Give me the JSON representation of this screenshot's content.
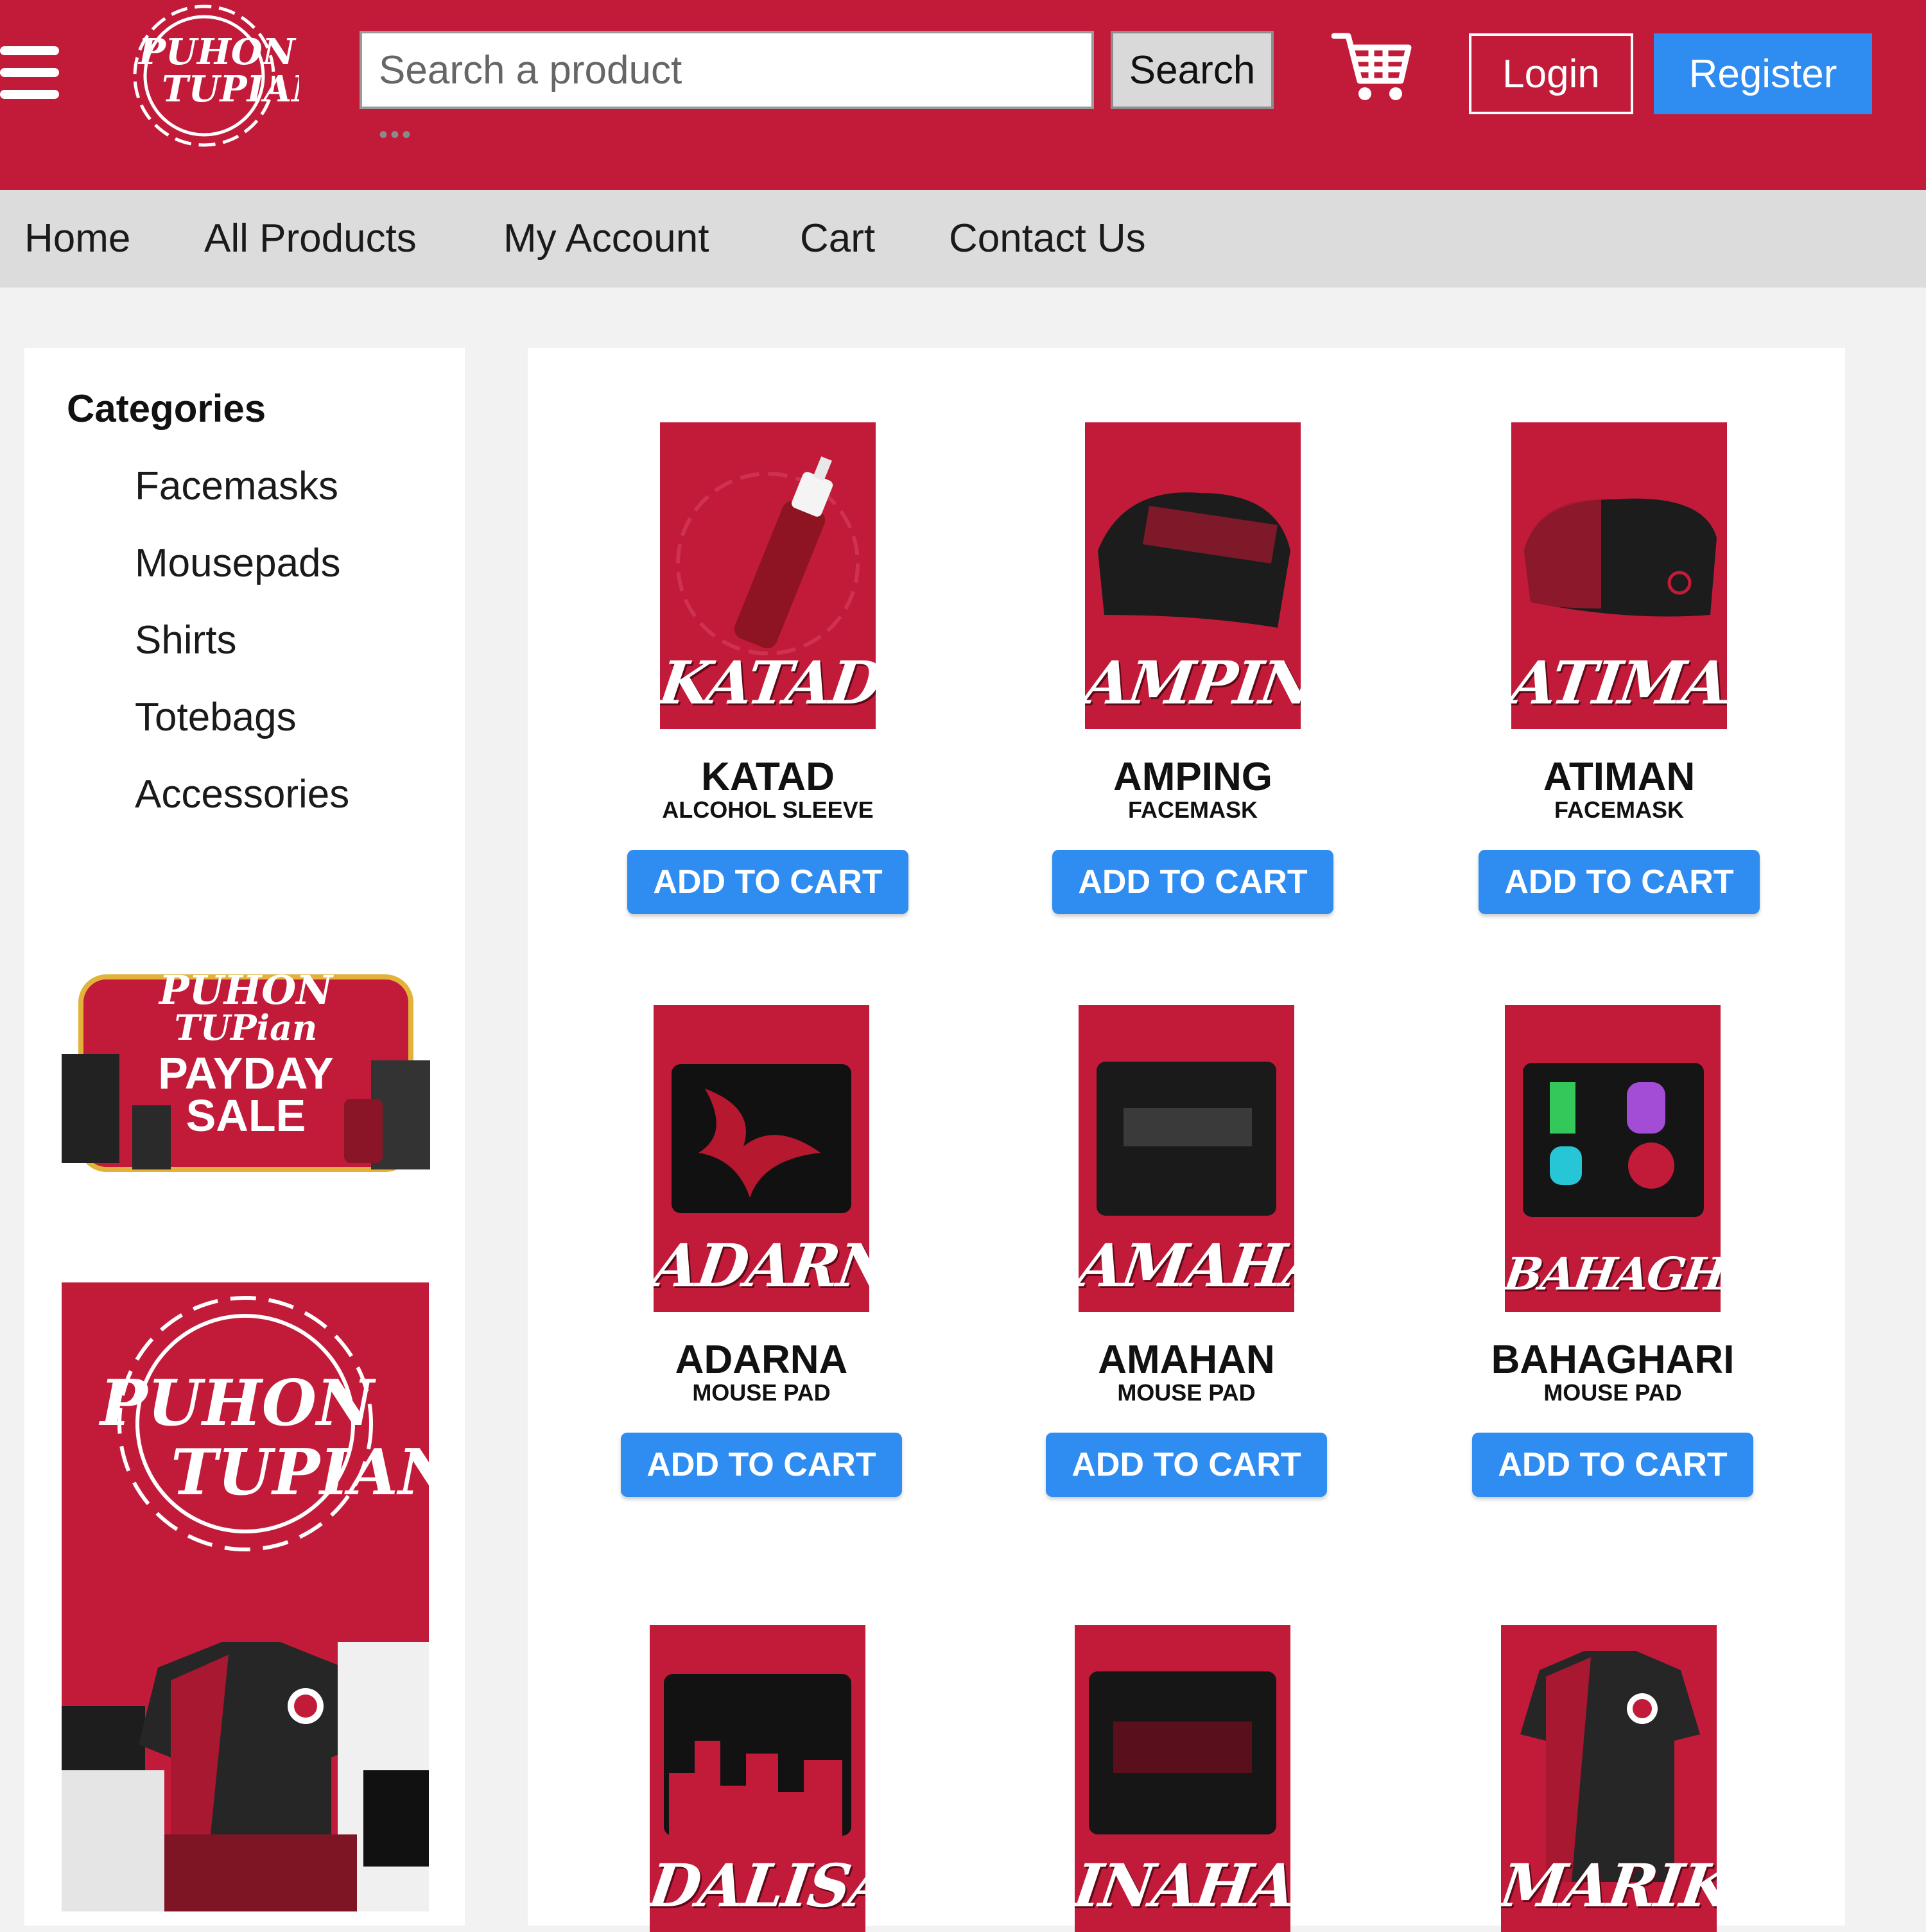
{
  "header": {
    "logo_text_line1": "PUHON",
    "logo_text_line2": "TUPIAN",
    "search_placeholder": "Search a product",
    "search_button": "Search",
    "login_button": "Login",
    "register_button": "Register"
  },
  "nav": {
    "items": [
      "Home",
      "All Products",
      "My Account",
      "Cart",
      "Contact Us"
    ]
  },
  "sidebar": {
    "title": "Categories",
    "categories": [
      "Facemasks",
      "Mousepads",
      "Shirts",
      "Totebags",
      "Accessories"
    ],
    "promo1": {
      "line1": "PUHON",
      "line2": "TUPian",
      "line3": "PAYDAY",
      "line4": "SALE"
    },
    "promo2": {
      "line1": "PUHON",
      "line2": "TUPIAN"
    }
  },
  "products": [
    {
      "image_label": "KATAD",
      "name": "KATAD",
      "type": "ALCOHOL SLEEVE",
      "button": "ADD TO CART"
    },
    {
      "image_label": "AMPING",
      "name": "AMPING",
      "type": "FACEMASK",
      "button": "ADD TO CART"
    },
    {
      "image_label": "ATIMAN",
      "name": "ATIMAN",
      "type": "FACEMASK",
      "button": "ADD TO CART"
    },
    {
      "image_label": "ADARNA",
      "name": "ADARNA",
      "type": "MOUSE PAD",
      "button": "ADD TO CART"
    },
    {
      "image_label": "AMAHAN",
      "name": "AMAHAN",
      "type": "MOUSE PAD",
      "button": "ADD TO CART"
    },
    {
      "image_label": "BAHAGHARI",
      "name": "BAHAGHARI",
      "type": "MOUSE PAD",
      "button": "ADD TO CART"
    },
    {
      "image_label": "DALISAY",
      "name": "",
      "type": "",
      "button": ""
    },
    {
      "image_label": "INAHAN",
      "name": "",
      "type": "",
      "button": ""
    },
    {
      "image_label": "MARIKIT",
      "name": "",
      "type": "",
      "button": ""
    }
  ],
  "colors": {
    "brand_red": "#c21b3a",
    "action_blue": "#2f8cf0",
    "nav_gray": "#dcdcdc",
    "page_bg": "#f2f2f2"
  }
}
